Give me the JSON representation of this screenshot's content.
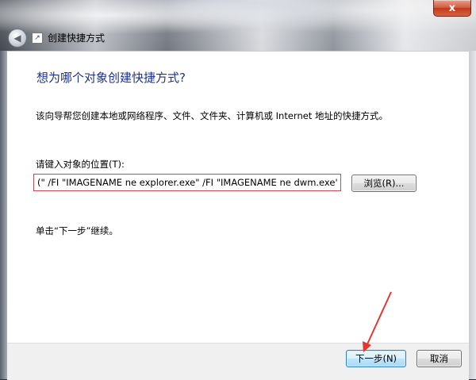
{
  "window": {
    "title": "创建快捷方式",
    "close_glyph": "x"
  },
  "wizard": {
    "heading": "想为哪个对象创建快捷方式?",
    "description": "该向导帮您创建本地或网络程序、文件、文件夹、计算机或 Internet 地址的快捷方式。",
    "location_label": "请键入对象的位置(T):",
    "location_value": "(\" /FI \"IMAGENAME ne explorer.exe\" /FI \"IMAGENAME ne dwm.exe\"",
    "browse_label": "浏览(R)...",
    "hint": "单击“下一步”继续。"
  },
  "footer": {
    "next_label": "下一步(N)",
    "cancel_label": "取消"
  },
  "icons": {
    "back": "back-arrow-icon",
    "wizard": "shortcut-wizard-icon",
    "close": "close-icon"
  },
  "colors": {
    "heading": "#1e3287",
    "input_border": "#c44b55",
    "annotation_arrow": "#e03a2e"
  }
}
